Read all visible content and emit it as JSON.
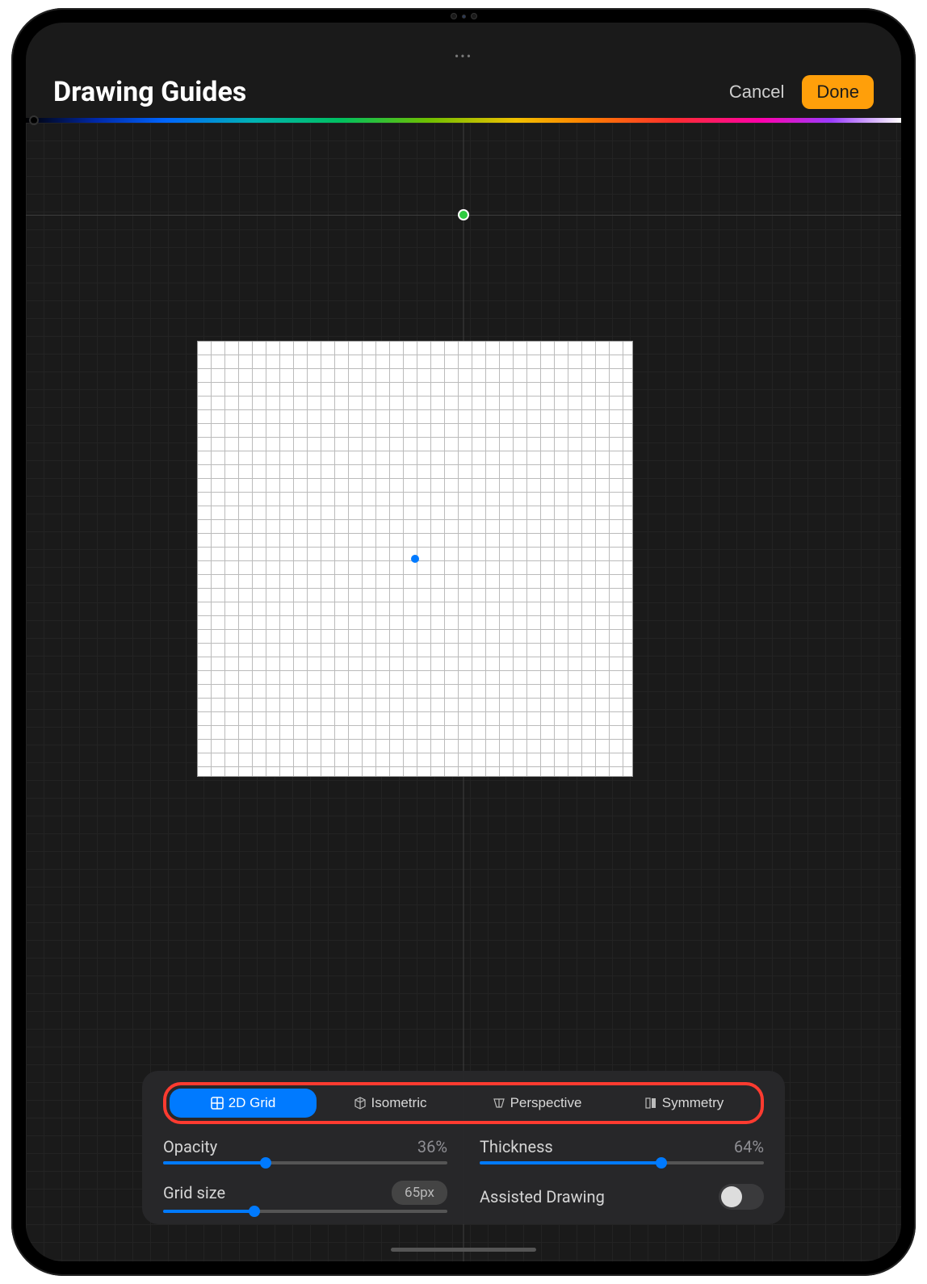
{
  "header": {
    "title": "Drawing Guides",
    "cancel": "Cancel",
    "done": "Done"
  },
  "guide_types": [
    {
      "label": "2D Grid",
      "active": true,
      "icon": "grid-icon"
    },
    {
      "label": "Isometric",
      "active": false,
      "icon": "cube-icon"
    },
    {
      "label": "Perspective",
      "active": false,
      "icon": "perspective-icon"
    },
    {
      "label": "Symmetry",
      "active": false,
      "icon": "symmetry-icon"
    }
  ],
  "sliders": {
    "opacity": {
      "label": "Opacity",
      "value_text": "36%",
      "percent": 36
    },
    "thickness": {
      "label": "Thickness",
      "value_text": "64%",
      "percent": 64
    },
    "grid_size": {
      "label": "Grid size",
      "value_text": "65px",
      "percent": 32
    }
  },
  "assisted_drawing": {
    "label": "Assisted Drawing",
    "on": false
  },
  "colors": {
    "accent": "#007aff",
    "done_button": "#ff9f0a",
    "highlight_ring": "#ff3b30"
  }
}
